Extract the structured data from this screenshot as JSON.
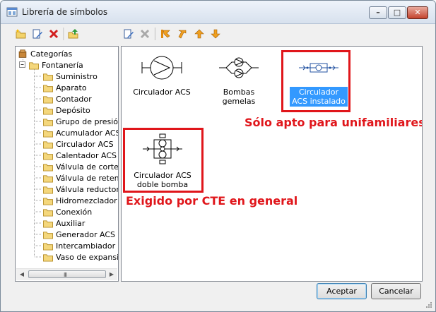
{
  "window": {
    "title": "Librería de símbolos",
    "controls": {
      "minimize": "–",
      "maximize": "□",
      "close": "✕"
    }
  },
  "toolbar": {
    "left_icons": [
      "new-folder-icon",
      "edit-icon",
      "delete-icon",
      "move-up-folder-icon"
    ],
    "right_icons": [
      "edit-symbol-icon",
      "delete-symbol-icon",
      "move-first-icon",
      "move-previous-icon",
      "move-up-icon",
      "move-down-icon"
    ]
  },
  "tree": {
    "root": "Categorías",
    "group": "Fontanería",
    "items": [
      "Suministro",
      "Aparato",
      "Contador",
      "Depósito",
      "Grupo de presión",
      "Acumulador ACS",
      "Circulador ACS",
      "Calentador ACS",
      "Válvula de corte",
      "Válvula de retenc",
      "Válvula reductora",
      "Hidromezclador",
      "Conexión",
      "Auxiliar",
      "Generador ACS",
      "Intercambiador",
      "Vaso de expansió"
    ],
    "scroll_grip": "III"
  },
  "symbols": [
    {
      "label": "Circulador ACS",
      "selected": false
    },
    {
      "label": "Bombas gemelas",
      "selected": false
    },
    {
      "label": "Circulador ACS instalado",
      "selected": true
    },
    {
      "label": "Circulador ACS doble bomba",
      "selected": false
    }
  ],
  "annotations": {
    "note_installed": "Sólo apto para unifamiliares",
    "note_double": "Exigido por CTE en general",
    "highlight_color": "#e0161b"
  },
  "buttons": {
    "accept": "Aceptar",
    "cancel": "Cancelar"
  }
}
